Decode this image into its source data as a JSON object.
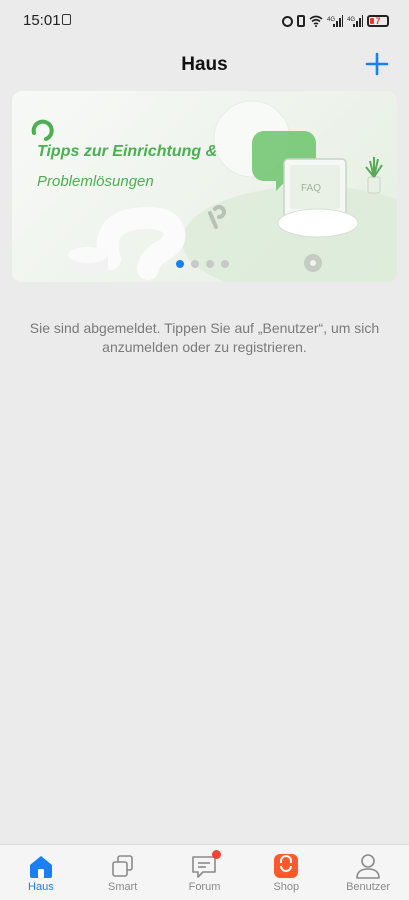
{
  "status_bar": {
    "time": "15:01",
    "battery": "7",
    "network_1": "4G",
    "network_2": "4G"
  },
  "header": {
    "title": "Haus",
    "add_icon": "plus-icon"
  },
  "banner": {
    "title": "Tipps zur Einrichtung &",
    "subtitle": "Problemlösungen",
    "faq_label": "FAQ",
    "page_count": 4,
    "active_index": 0
  },
  "main": {
    "message": "Sie sind abgemeldet. Tippen Sie auf „Benutzer“, um sich anzumelden oder zu registrieren."
  },
  "bottom_nav": {
    "items": [
      {
        "label": "Haus",
        "icon": "home-icon",
        "active": true
      },
      {
        "label": "Smart",
        "icon": "smart-icon",
        "active": false
      },
      {
        "label": "Forum",
        "icon": "forum-icon",
        "active": false,
        "badge": true
      },
      {
        "label": "Shop",
        "icon": "shop-icon",
        "active": false
      },
      {
        "label": "Benutzer",
        "icon": "user-icon",
        "active": false
      }
    ]
  },
  "colors": {
    "accent": "#1a7ff0",
    "banner_green": "#4caf50",
    "badge": "#f44336",
    "shop": "#ff5722"
  }
}
